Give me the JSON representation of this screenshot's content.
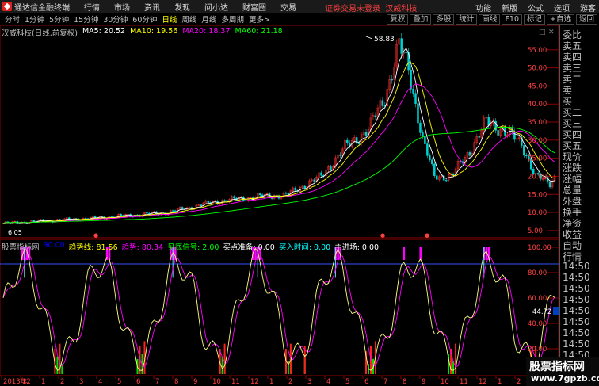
{
  "titlebar": {
    "app_title": "通达信金融终端",
    "menus": [
      "行情",
      "市场",
      "资讯",
      "发现",
      "问小达",
      "财富圈",
      "交易"
    ],
    "alert": "证劵交易未登录",
    "stock_name": "汉威科技",
    "right_items": [
      "功能",
      "新版",
      "公式",
      "选项",
      "游客"
    ]
  },
  "toolbar": {
    "periods": [
      "分时",
      "1分钟",
      "5分钟",
      "15分钟",
      "30分钟",
      "60分钟",
      "日线",
      "周线",
      "月线",
      "多周期",
      "更多>"
    ],
    "active_period": "日线",
    "right_buttons": [
      "复权",
      "叠加",
      "多股",
      "统计",
      "画线",
      "F10",
      "标记",
      "+自选",
      "返回"
    ]
  },
  "main_chart": {
    "label": "汉威科技(日线,前复权)",
    "ma5": "MA5: 20.52",
    "ma10": "MA10: 19.56",
    "ma20": "MA20: 18.37",
    "ma60": "MA60: 21.18",
    "high_label": "58.83",
    "low_label": "6.05",
    "price_ticks": [
      "55.00",
      "50.00",
      "45.00",
      "40.00",
      "35.00",
      "30.00",
      "25.00",
      "20.00",
      "15.00",
      "10.00",
      "5.00"
    ],
    "colors": {
      "ma5": "#ffffff",
      "ma10": "#ffff00",
      "ma20": "#ff00ff",
      "ma60": "#00ff00"
    }
  },
  "indicator": {
    "name": "股票指标网",
    "values": [
      {
        "label": "90.00",
        "color": "#0000ff"
      },
      {
        "label": "趋势线: 81.56",
        "color": "#ffff00"
      },
      {
        "label": "趋势: 80.34",
        "color": "#ff00ff"
      },
      {
        "label": "见底信号: 2.00",
        "color": "#00ff00"
      },
      {
        "label": "买点准备: 0.00",
        "color": "#ffffff"
      },
      {
        "label": "买入时间: 0.00",
        "color": "#00ffff"
      },
      {
        "label": "主进场: 0.00",
        "color": "#ffffff"
      }
    ],
    "ticks": [
      "100.00",
      "80.00",
      "60.00",
      "40.00",
      "20.00"
    ],
    "current_value": "44.72"
  },
  "time_axis": {
    "labels": [
      "2013年",
      "12",
      "1",
      "2",
      "3",
      "4",
      "5",
      "6",
      "7",
      "8",
      "9",
      "10",
      "11",
      "12",
      "1",
      "2",
      "3",
      "4",
      "5",
      "6",
      "7",
      "8",
      "9",
      "10",
      "11",
      "12",
      "1",
      "2",
      "3"
    ]
  },
  "side_panel": {
    "items": [
      "委比",
      "卖五",
      "卖四",
      "卖三",
      "卖二",
      "卖一",
      "买一",
      "买二",
      "买三",
      "买四",
      "买五",
      "现价",
      "涨跌",
      "涨幅",
      "总量",
      "外盘",
      "换手",
      "净资",
      "收益",
      "自动",
      "行情",
      "14:50",
      "14:50",
      "14:50",
      "14:50",
      "14:50",
      "14:50",
      "14:50",
      "14:50",
      "14:50",
      "14:50"
    ]
  },
  "watermark": {
    "title": "股票指标网",
    "url": "www.7gpzb.com"
  }
}
